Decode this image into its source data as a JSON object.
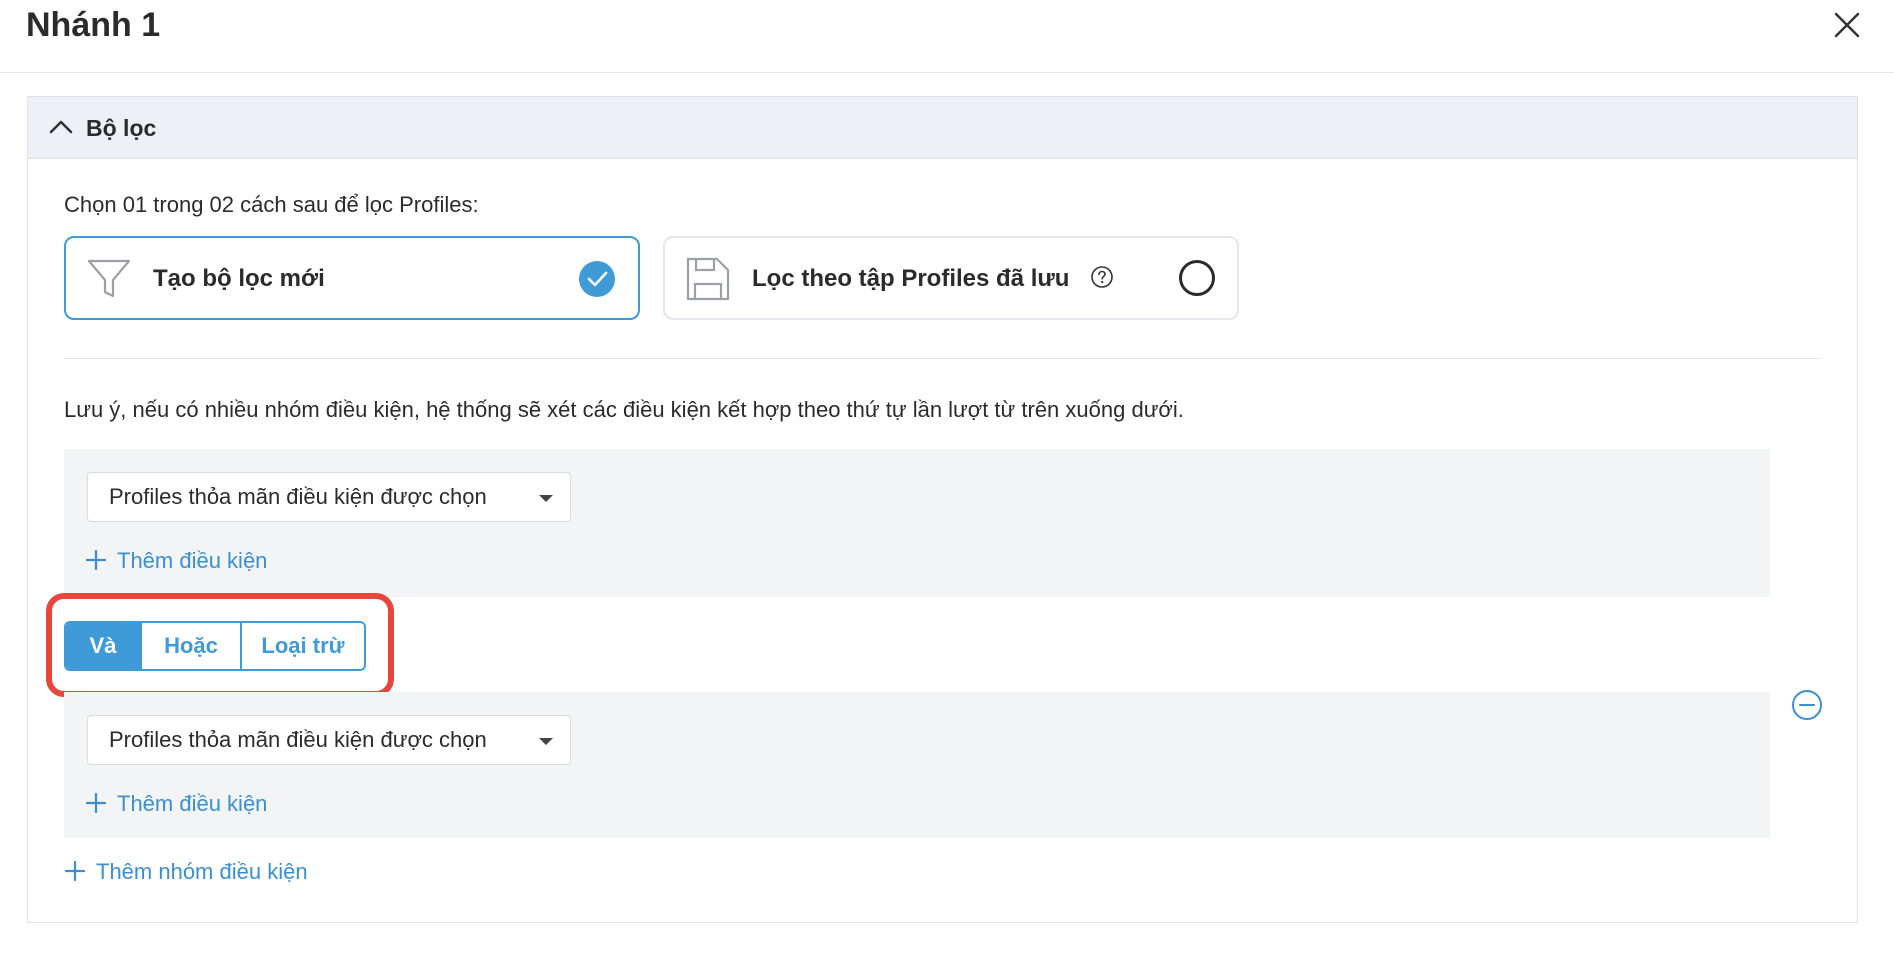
{
  "modal": {
    "title": "Nhánh 1"
  },
  "filter": {
    "section_title": "Bộ lọc",
    "instruction": "Chọn 01 trong 02 cách sau để lọc Profiles:",
    "options": [
      {
        "label": "Tạo bộ lọc mới",
        "selected": true
      },
      {
        "label": "Lọc theo tập Profiles đã lưu",
        "selected": false
      }
    ],
    "note": "Lưu ý, nếu có nhiều nhóm điều kiện, hệ thống sẽ xét các điều kiện kết hợp theo thứ tự lần lượt từ trên xuống dưới.",
    "groups": [
      {
        "select_value": "Profiles thỏa mãn điều kiện được chọn",
        "add_condition": "Thêm điều kiện"
      },
      {
        "select_value": "Profiles thỏa mãn điều kiện được chọn",
        "add_condition": "Thêm điều kiện"
      }
    ],
    "operators": {
      "and": "Và",
      "or": "Hoặc",
      "exclude": "Loại trừ",
      "active": "and"
    },
    "add_group": "Thêm nhóm điều kiện"
  },
  "colors": {
    "accent": "#3e9bd7",
    "highlight": "#e8453c",
    "group_bg": "#f3f4f6",
    "header_bg": "#edf1f6"
  }
}
